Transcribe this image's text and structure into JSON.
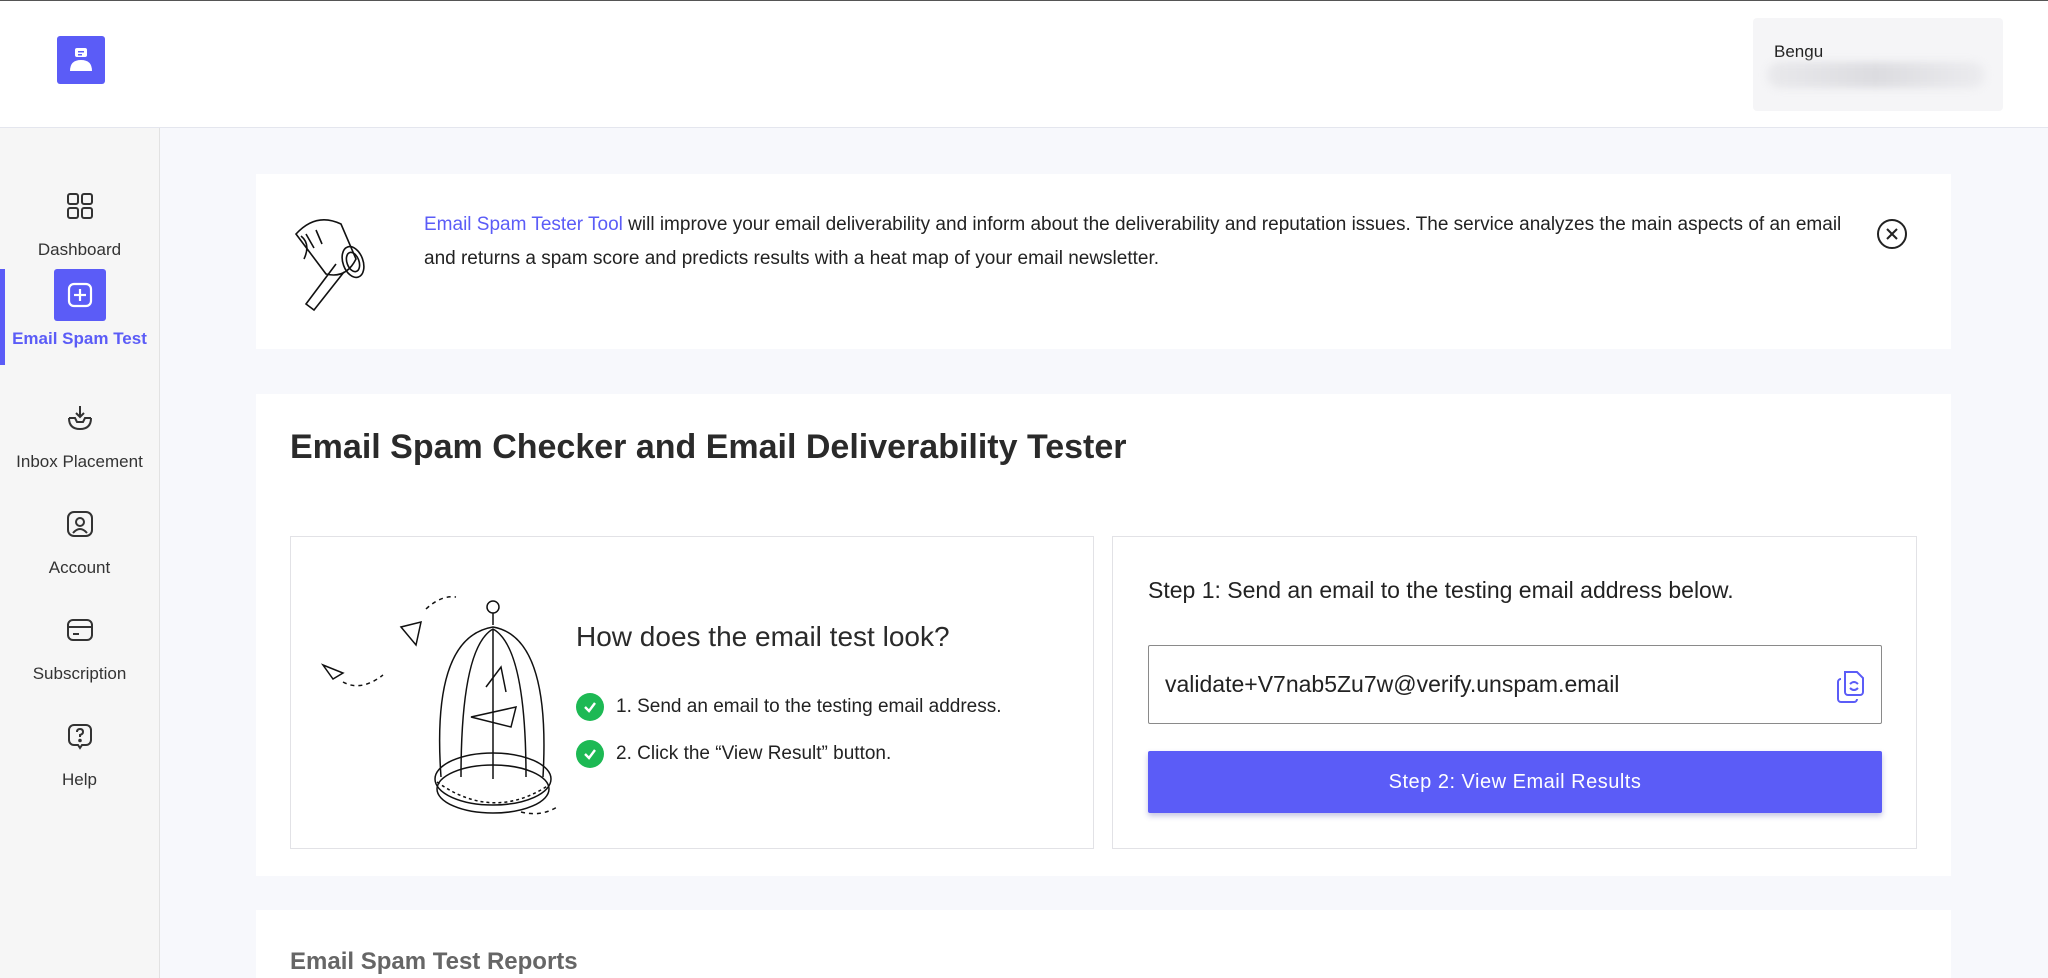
{
  "header": {
    "user_name": "Bengu"
  },
  "sidebar": {
    "items": [
      {
        "label": "Dashboard",
        "icon": "grid-icon"
      },
      {
        "label": "Email Spam Test",
        "icon": "plus-square-icon",
        "active": true
      },
      {
        "label": "Inbox Placement",
        "icon": "inbox-download-icon"
      },
      {
        "label": "Account",
        "icon": "user-square-icon"
      },
      {
        "label": "Subscription",
        "icon": "card-icon"
      },
      {
        "label": "Help",
        "icon": "help-bubble-icon"
      }
    ]
  },
  "banner": {
    "link_text": "Email Spam Tester Tool",
    "text": " will improve your email deliverability and inform about the deliverability and reputation issues. The service analyzes the main aspects of an email and returns a spam score and predicts results with a heat map of your email newsletter."
  },
  "main": {
    "title": "Email Spam Checker and Email Deliverability Tester",
    "how": {
      "title": "How does the email test look?",
      "steps": [
        "1. Send an email to the testing email address.",
        "2. Click the “View Result” button."
      ]
    },
    "send": {
      "step1": "Step 1: Send an email to the testing email address below.",
      "email": "validate+V7nab5Zu7w@verify.unspam.email",
      "button": "Step 2: View Email Results"
    }
  },
  "reports": {
    "title": "Email Spam Test Reports"
  },
  "colors": {
    "accent": "#5b5cf7",
    "success": "#1db954"
  }
}
